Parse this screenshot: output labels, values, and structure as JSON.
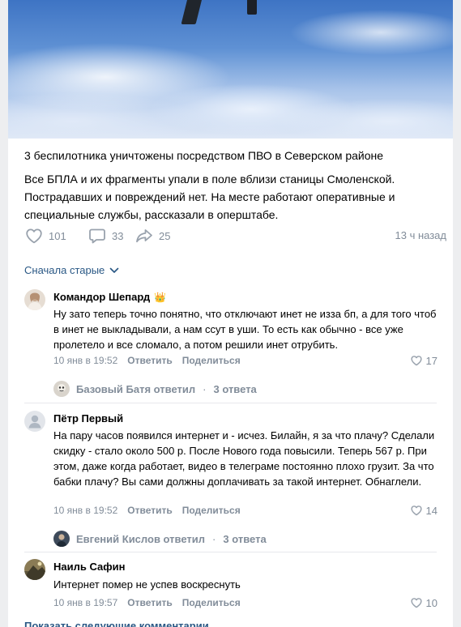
{
  "post": {
    "title": "3 беспилотника уничтожены посредством ПВО в Северском районе",
    "body": "Все БПЛА и их фрагменты упали в поле вблизи станицы Смоленской. Пострадавших и повреждений нет. На месте работают оперативные и специальные службы, рассказали в оперштабе.",
    "likes": "101",
    "comments": "33",
    "shares": "25",
    "time": "13 ч назад"
  },
  "sort": {
    "label": "Сначала старые"
  },
  "comments": [
    {
      "author": "Командор Шепард",
      "badge": "👑",
      "text": "Ну зато теперь точно понятно, что отключают инет не изза бп, а для того чтоб в инет не выкладывали, а нам ссут в уши. То есть как обычно - все уже пролетело и все сломало, а потом решили инет отрубить.",
      "date": "10 янв в 19:52",
      "reply": "Ответить",
      "share": "Поделиться",
      "likes": "17",
      "thread": {
        "who": "Базовый Батя ответил",
        "count": "3 ответа"
      }
    },
    {
      "author": "Пётр Первый",
      "text": "На пару часов появился интернет и - исчез. Билайн, я за что плачу? Сделали скидку - стало около 500 р. После Нового года повысили. Теперь 567 р. При этом, даже когда работает, видео в телеграме постоянно плохо грузит. За что бабки плачу? Вы сами должны доплачивать за такой интернет. Обнаглели.",
      "date": "10 янв в 19:52",
      "reply": "Ответить",
      "share": "Поделиться",
      "likes": "14",
      "thread": {
        "who": "Евгений Кислов ответил",
        "count": "3 ответа"
      }
    },
    {
      "author": "Наиль Сафин",
      "text": "Интернет помер не успев воскреснуть",
      "date": "10 янв в 19:57",
      "reply": "Ответить",
      "share": "Поделиться",
      "likes": "10"
    }
  ],
  "footer": {
    "more": "Показать следующие комментарии"
  },
  "colors": {
    "accent": "#2a5885",
    "muted": "#818c99",
    "background": "#edeef0"
  }
}
